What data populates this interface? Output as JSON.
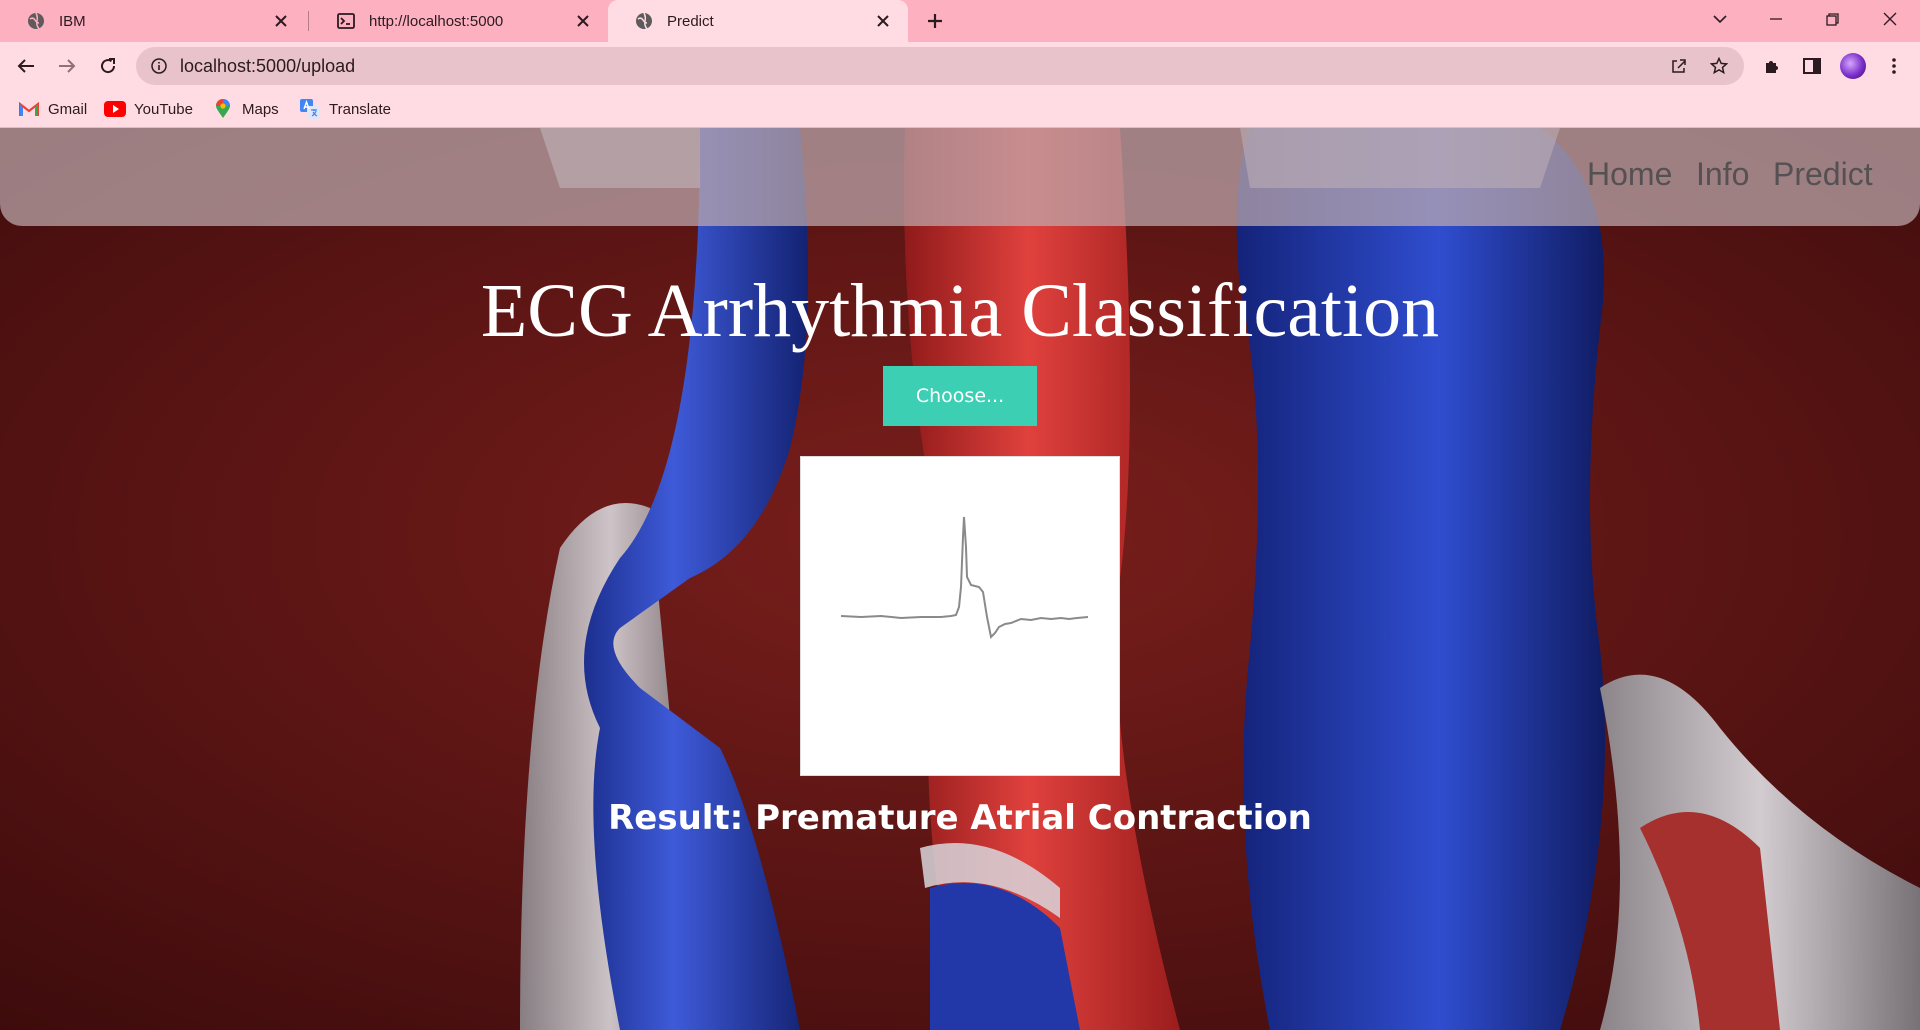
{
  "browser": {
    "tabs": [
      {
        "title": "IBM",
        "icon": "globe-icon"
      },
      {
        "title": "http://localhost:5000",
        "icon": "terminal-icon"
      },
      {
        "title": "Predict",
        "icon": "globe-icon",
        "active": true
      }
    ],
    "url": "localhost:5000/upload",
    "bookmarks": [
      {
        "label": "Gmail",
        "icon": "gmail-icon"
      },
      {
        "label": "YouTube",
        "icon": "youtube-icon"
      },
      {
        "label": "Maps",
        "icon": "maps-icon"
      },
      {
        "label": "Translate",
        "icon": "translate-icon"
      }
    ],
    "accent": "#fdb0bf"
  },
  "page": {
    "nav": [
      "Home",
      "Info",
      "Predict"
    ],
    "title": "ECG Arrhythmia Classification",
    "choose_label": "Choose...",
    "result_text": "Result: Premature Atrial Contraction",
    "button_color": "#3ccfb4",
    "preview_icon": "ecg-waveform-image"
  }
}
